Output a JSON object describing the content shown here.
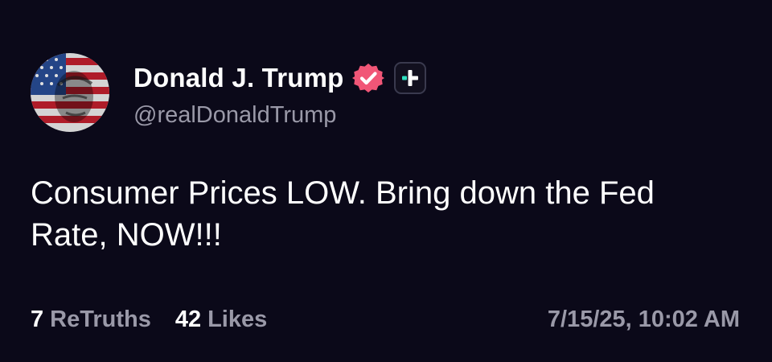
{
  "post": {
    "author": {
      "display_name": "Donald J. Trump",
      "handle": "@realDonaldTrump",
      "verified_icon": "verified-badge-icon",
      "follow_icon": "plus-icon",
      "avatar": "profile-avatar"
    },
    "text": "Consumer Prices LOW. Bring down the Fed Rate, NOW!!!",
    "stats": {
      "retruths_count": "7",
      "retruths_label": "ReTruths",
      "likes_count": "42",
      "likes_label": "Likes"
    },
    "timestamp": "7/15/25, 10:02 AM"
  },
  "colors": {
    "background": "#0b0919",
    "text_primary": "#ffffff",
    "text_secondary": "#9a99a8",
    "verified_badge": "#f15677",
    "accent_teal": "#2ee0c0"
  }
}
